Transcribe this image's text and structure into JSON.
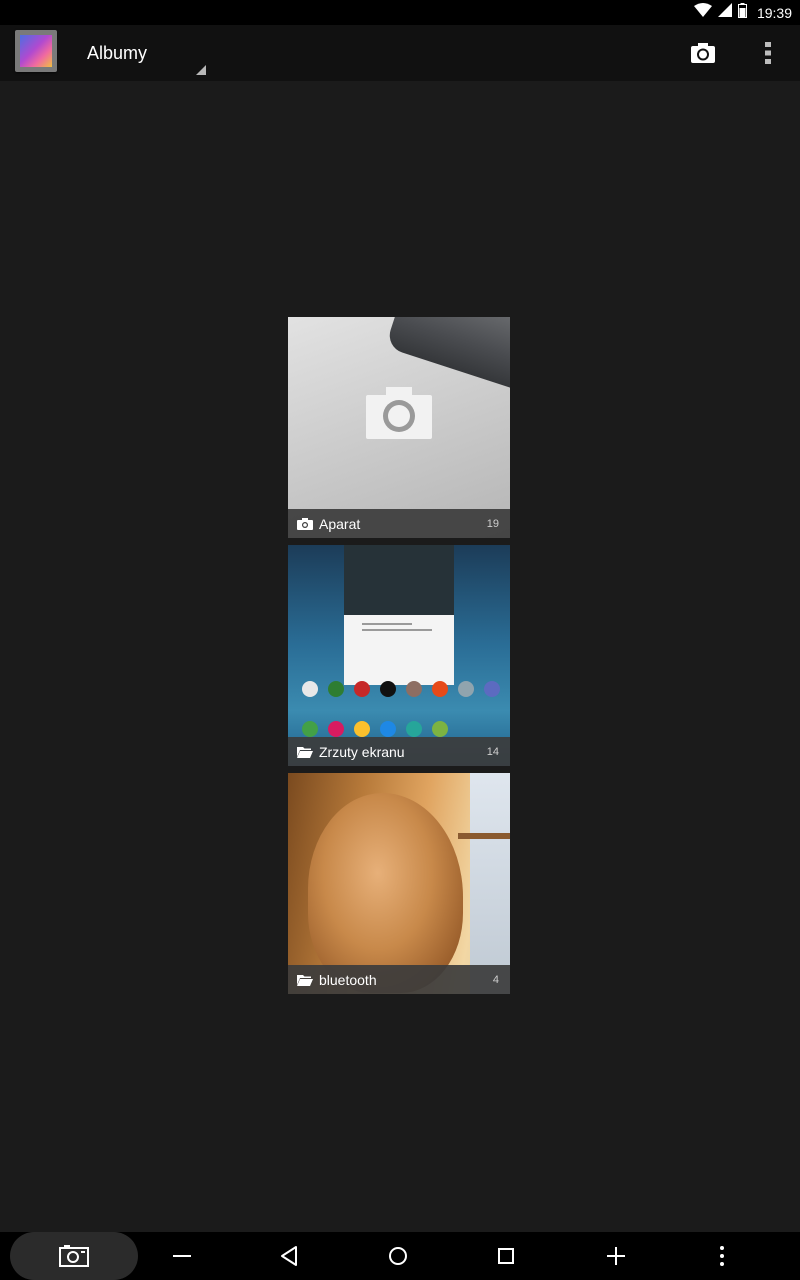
{
  "status_bar": {
    "time": "19:39",
    "icons": [
      "wifi-icon",
      "signal-icon",
      "battery-icon"
    ]
  },
  "action_bar": {
    "app_icon": "gallery-app-icon",
    "spinner_label": "Albumy",
    "actions": [
      "camera-icon",
      "overflow-menu-icon"
    ]
  },
  "albums": [
    {
      "title": "Aparat",
      "count": "19",
      "icon": "camera-icon"
    },
    {
      "title": "Zrzuty ekranu",
      "count": "14",
      "icon": "folder-icon"
    },
    {
      "title": "bluetooth",
      "count": "4",
      "icon": "folder-icon"
    }
  ],
  "nav_bar": {
    "buttons": [
      "screenshot-camera-icon",
      "volume-down-icon",
      "back-icon",
      "home-icon",
      "recents-icon",
      "volume-up-icon",
      "menu-icon"
    ]
  },
  "colors": {
    "background": "#1b1b1b",
    "action_bar": "#111111",
    "caption_bar": "#3c3c3c"
  }
}
